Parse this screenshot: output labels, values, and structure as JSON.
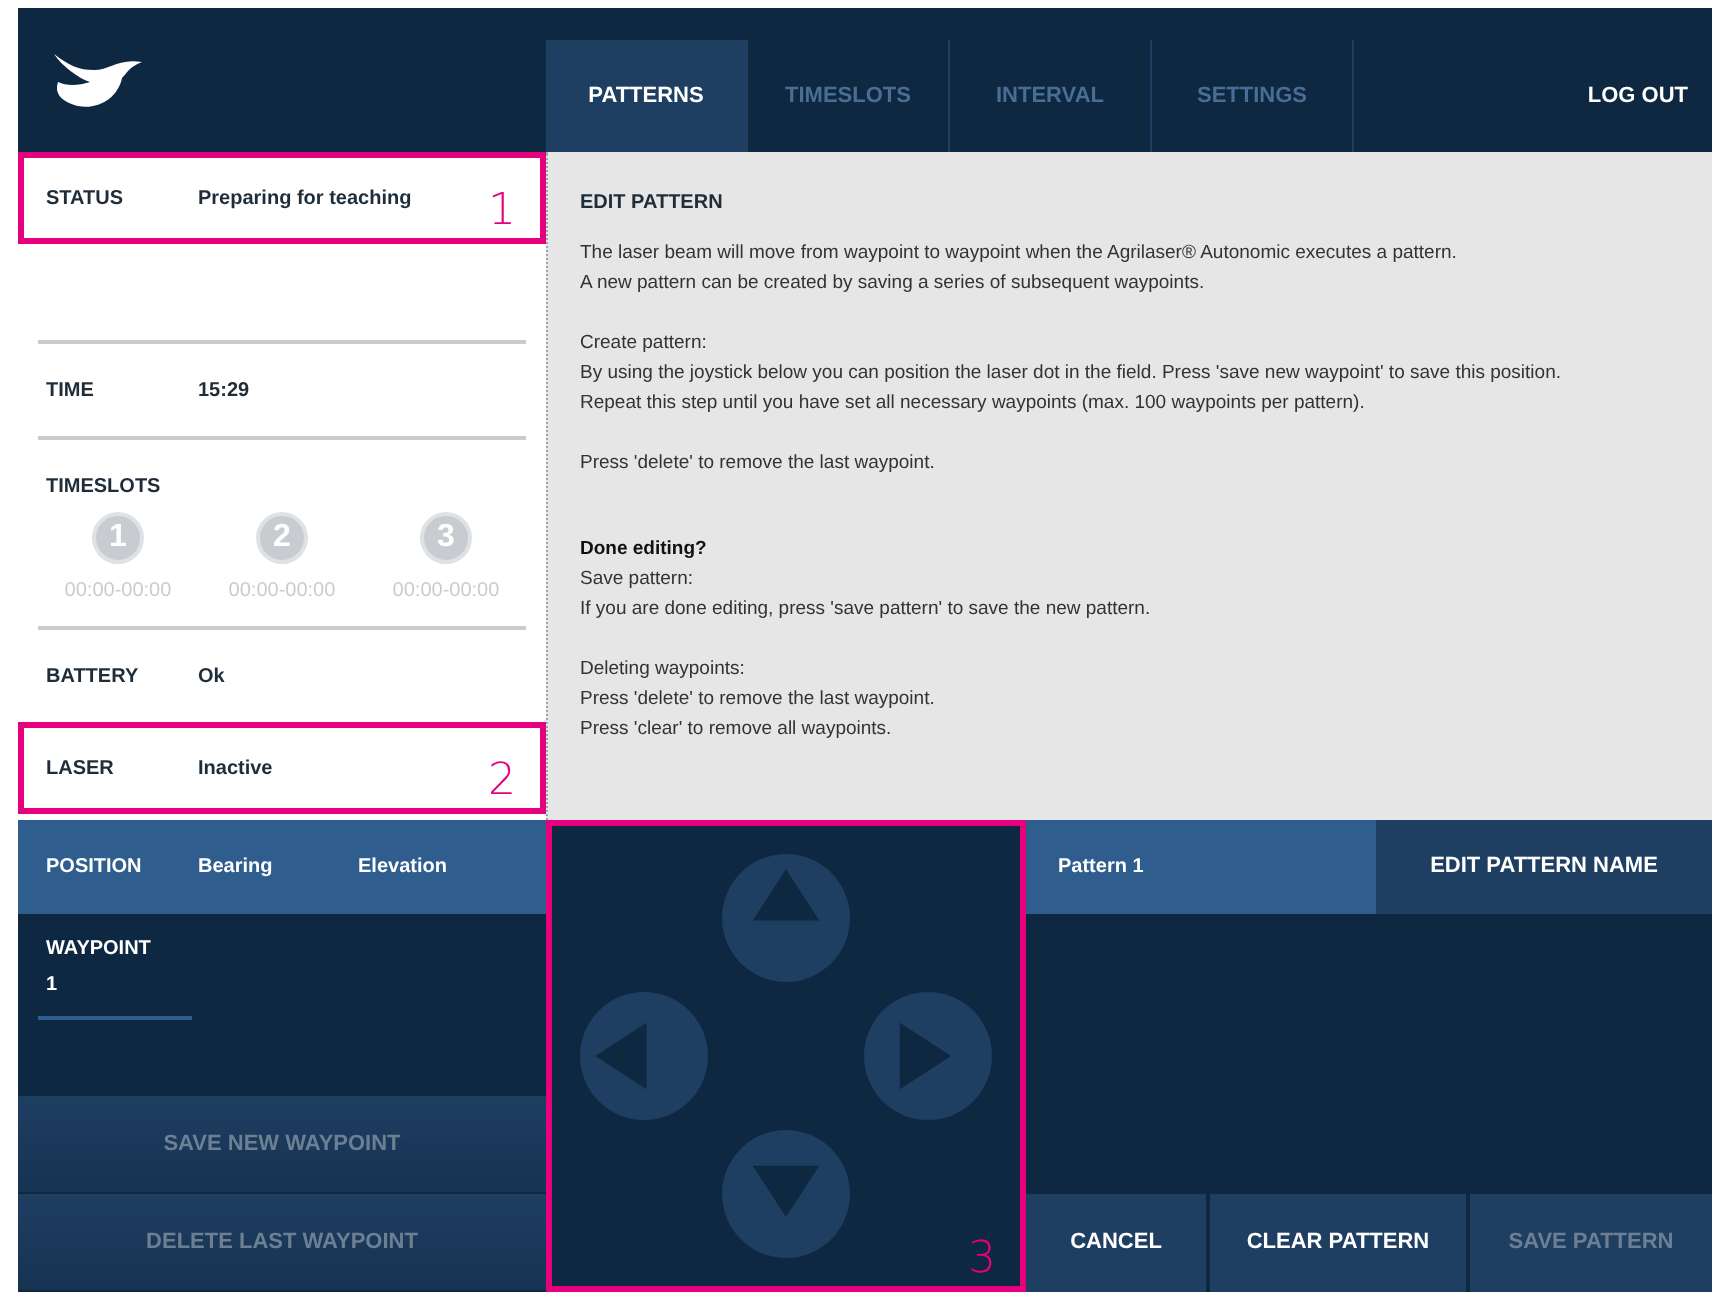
{
  "tabs": [
    {
      "label": "PATTERNS",
      "selected": true
    },
    {
      "label": "TIMESLOTS",
      "selected": false
    },
    {
      "label": "INTERVAL",
      "selected": false
    },
    {
      "label": "SETTINGS",
      "selected": false
    }
  ],
  "logout": "LOG OUT",
  "status": {
    "label": "STATUS",
    "value": "Preparing for teaching",
    "callout": "1"
  },
  "time": {
    "label": "TIME",
    "value": "15:29"
  },
  "timeslots": {
    "label": "TIMESLOTS",
    "slots": [
      {
        "number": "1",
        "range": "00:00-00:00"
      },
      {
        "number": "2",
        "range": "00:00-00:00"
      },
      {
        "number": "3",
        "range": "00:00-00:00"
      }
    ]
  },
  "battery": {
    "label": "BATTERY",
    "value": "Ok"
  },
  "laser": {
    "label": "LASER",
    "value": "Inactive",
    "callout": "2"
  },
  "edit_pattern": {
    "title": "EDIT PATTERN",
    "blocks": [
      {
        "lines": [
          {
            "kind": "text",
            "text": "The laser beam will move from waypoint to waypoint when the Agrilaser® Autonomic executes a pattern."
          },
          {
            "kind": "text",
            "text": "A new pattern can be created by saving a series of subsequent waypoints."
          }
        ]
      },
      {
        "lines": [
          {
            "kind": "text",
            "text": "Create pattern:"
          },
          {
            "kind": "text",
            "text": "By using the joystick below you can position the laser dot in the field. Press 'save new waypoint' to save this position."
          },
          {
            "kind": "text",
            "text": "Repeat this step until you have set all necessary waypoints (max. 100 waypoints per pattern)."
          }
        ]
      },
      {
        "lines": [
          {
            "kind": "text",
            "text": "Press 'delete' to remove the last waypoint."
          }
        ]
      },
      {
        "lines": [
          {
            "kind": "bold",
            "text": "Done editing?"
          },
          {
            "kind": "text",
            "text": "Save pattern:"
          },
          {
            "kind": "text",
            "text": "If you are done editing, press 'save pattern' to save the new pattern."
          }
        ]
      },
      {
        "lines": [
          {
            "kind": "text",
            "text": "Deleting waypoints:"
          },
          {
            "kind": "text",
            "text": "Press 'delete' to remove the last waypoint."
          },
          {
            "kind": "text",
            "text": "Press 'clear' to remove all waypoints."
          }
        ]
      }
    ]
  },
  "position": {
    "label": "POSITION",
    "columns": [
      "Bearing",
      "Elevation"
    ]
  },
  "waypoint": {
    "label": "WAYPOINT",
    "value": "1"
  },
  "left_buttons": [
    {
      "label": "SAVE NEW WAYPOINT",
      "disabled": true
    },
    {
      "label": "DELETE LAST WAYPOINT",
      "disabled": true
    }
  ],
  "joystick": {
    "callout": "3"
  },
  "pattern": {
    "name": "Pattern 1",
    "edit_button": "EDIT PATTERN NAME"
  },
  "pattern_buttons": [
    {
      "label": "CANCEL",
      "disabled": false
    },
    {
      "label": "CLEAR PATTERN",
      "disabled": false
    },
    {
      "label": "SAVE PATTERN",
      "disabled": true
    }
  ]
}
